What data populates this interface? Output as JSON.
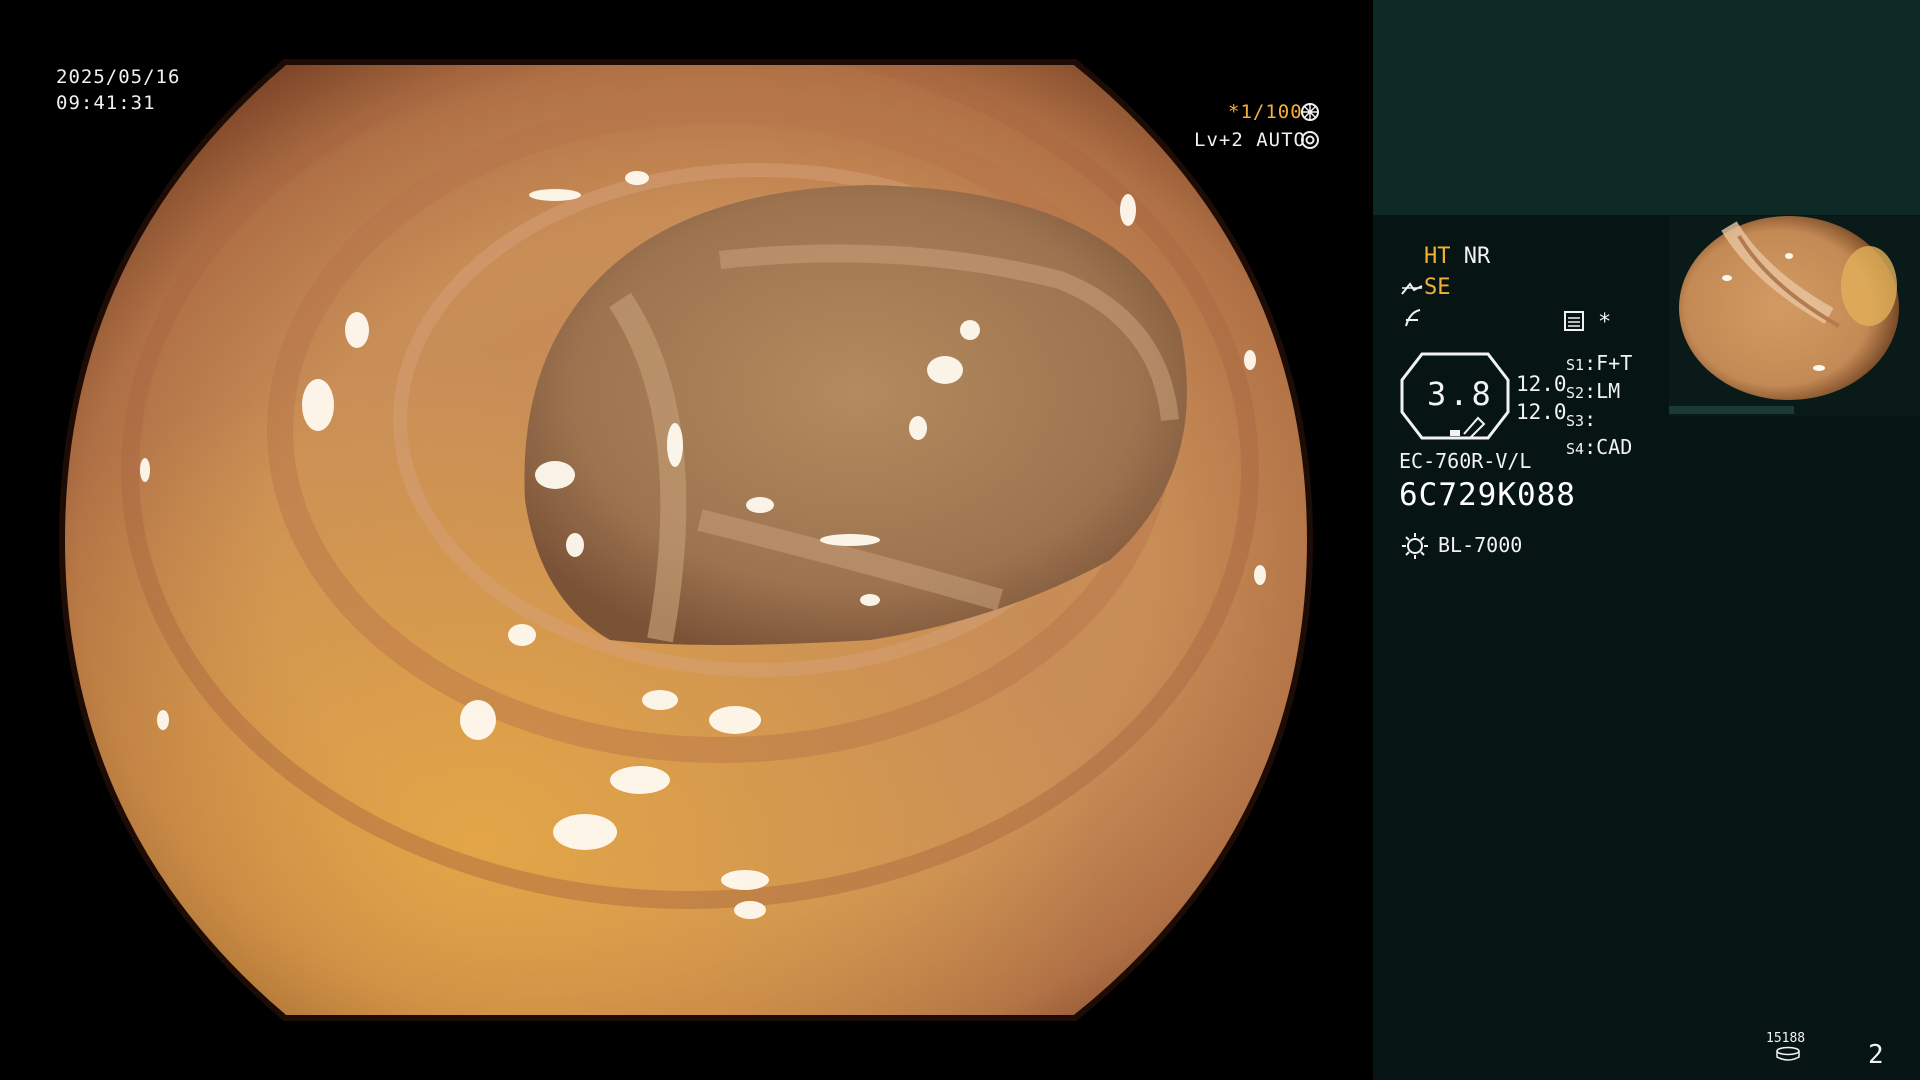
{
  "screen": {
    "date": "2025/05/16",
    "time": "09:41:31",
    "shutter": "*1/100",
    "level": "Lv+2 AUTO",
    "modes": {
      "ht": "HT",
      "nr": "NR",
      "se": "SE",
      "star": "*"
    },
    "zoom_value": "3.8",
    "values": [
      "12.0",
      "12.0"
    ],
    "switches": [
      {
        "key": "S1",
        "value": "F+T"
      },
      {
        "key": "S2",
        "value": "LM"
      },
      {
        "key": "S3",
        "value": ""
      },
      {
        "key": "S4",
        "value": "CAD"
      }
    ],
    "scope_model": "EC-760R-V/L",
    "scope_serial": "6C729K088",
    "light_source": "BL-7000",
    "counter": "15188",
    "page_index": "2"
  },
  "colors": {
    "amber": "#f2b233",
    "panel_top": "#0d2a27",
    "panel_bg": "#061413"
  },
  "icons": [
    "aperture-icon",
    "auto-iris-icon",
    "structure-enhance-icon",
    "color-enhance-icon",
    "chart-icon",
    "light-bulb-icon",
    "disk-icon"
  ]
}
